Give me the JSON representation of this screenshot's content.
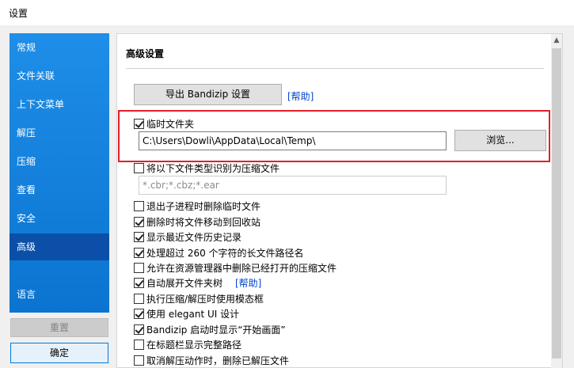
{
  "window": {
    "title": "设置"
  },
  "sidebar": {
    "items": [
      {
        "label": "常规"
      },
      {
        "label": "文件关联"
      },
      {
        "label": "上下文菜单"
      },
      {
        "label": "解压"
      },
      {
        "label": "压缩"
      },
      {
        "label": "查看"
      },
      {
        "label": "安全"
      },
      {
        "label": "高级"
      },
      {
        "label": "语言"
      }
    ],
    "active": "高级"
  },
  "footer": {
    "reset_label": "重置",
    "ok_label": "确定"
  },
  "panel": {
    "title": "高级设置",
    "export_button": "导出 Bandizip 设置",
    "help_link": "[帮助]",
    "temp_folder": {
      "label": "临时文件夹",
      "checked": true,
      "path": "C:\\Users\\Dowli\\AppData\\Local\\Temp\\",
      "browse_label": "浏览..."
    },
    "treat_as_archive": {
      "label": "将以下文件类型识别为压缩文件",
      "checked": false,
      "value": "*.cbr;*.cbz;*.ear"
    },
    "options": [
      {
        "label": "退出子进程时删除临时文件",
        "checked": false
      },
      {
        "label": "删除时将文件移动到回收站",
        "checked": true
      },
      {
        "label": "显示最近文件历史记录",
        "checked": true
      },
      {
        "label": "处理超过 260 个字符的长文件路径名",
        "checked": true
      },
      {
        "label": "允许在资源管理器中删除已经打开的压缩文件",
        "checked": false
      },
      {
        "label": "自动展开文件夹树",
        "checked": true
      },
      {
        "label": "执行压缩/解压时使用模态框",
        "checked": false
      },
      {
        "label": "使用 elegant UI 设计",
        "checked": true
      },
      {
        "label": "Bandizip 启动时显示“开始画面”",
        "checked": true
      },
      {
        "label": "在标题栏显示完整路径",
        "checked": false
      },
      {
        "label": "取消解压动作时，删除已解压文件",
        "checked": false
      }
    ],
    "auto_expand_help": "[帮助]"
  }
}
